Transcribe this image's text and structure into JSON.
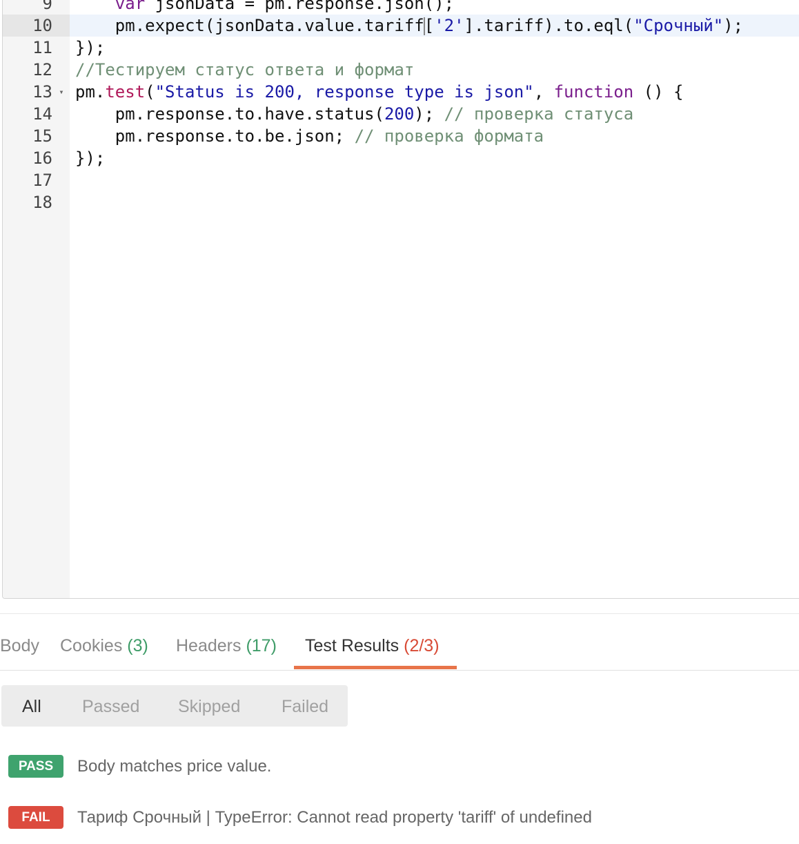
{
  "editor": {
    "lines": [
      {
        "n": "9",
        "active": false,
        "fold": false,
        "tokens": [
          {
            "t": "    ",
            "c": "text"
          },
          {
            "t": "var",
            "c": "kw"
          },
          {
            "t": " jsonData = pm.response.json();",
            "c": "text"
          }
        ]
      },
      {
        "n": "10",
        "active": true,
        "fold": false,
        "tokens": [
          {
            "t": "    pm.expect(jsonData.value.tariff",
            "c": "text"
          },
          {
            "t": "|",
            "c": "cursor"
          },
          {
            "t": "[",
            "c": "text"
          },
          {
            "t": "'2'",
            "c": "str"
          },
          {
            "t": "].tariff).to.eql(",
            "c": "text"
          },
          {
            "t": "\"Срочный\"",
            "c": "str"
          },
          {
            "t": ");",
            "c": "text"
          }
        ]
      },
      {
        "n": "11",
        "active": false,
        "fold": false,
        "tokens": [
          {
            "t": "});",
            "c": "text"
          }
        ]
      },
      {
        "n": "12",
        "active": false,
        "fold": false,
        "tokens": [
          {
            "t": "//Тестируем статус ответа и формат",
            "c": "com"
          }
        ]
      },
      {
        "n": "13",
        "active": false,
        "fold": true,
        "tokens": [
          {
            "t": "pm.",
            "c": "text"
          },
          {
            "t": "test",
            "c": "fn"
          },
          {
            "t": "(",
            "c": "text"
          },
          {
            "t": "\"Status is 200, response type is json\"",
            "c": "str"
          },
          {
            "t": ", ",
            "c": "text"
          },
          {
            "t": "function",
            "c": "kw"
          },
          {
            "t": " () {",
            "c": "text"
          }
        ]
      },
      {
        "n": "14",
        "active": false,
        "fold": false,
        "tokens": [
          {
            "t": "    pm.response.to.have.status(",
            "c": "text"
          },
          {
            "t": "200",
            "c": "num"
          },
          {
            "t": "); ",
            "c": "text"
          },
          {
            "t": "// проверка статуса",
            "c": "com"
          }
        ]
      },
      {
        "n": "15",
        "active": false,
        "fold": false,
        "tokens": [
          {
            "t": "    pm.response.to.be.json; ",
            "c": "text"
          },
          {
            "t": "// проверка формата",
            "c": "com"
          }
        ]
      },
      {
        "n": "16",
        "active": false,
        "fold": false,
        "tokens": [
          {
            "t": "});",
            "c": "text"
          }
        ]
      },
      {
        "n": "17",
        "active": false,
        "fold": false,
        "tokens": []
      },
      {
        "n": "18",
        "active": false,
        "fold": false,
        "tokens": []
      }
    ]
  },
  "tabs": {
    "body": {
      "label": "Body"
    },
    "cookies": {
      "label": "Cookies",
      "count": "(3)"
    },
    "headers": {
      "label": "Headers",
      "count": "(17)"
    },
    "test_results": {
      "label": "Test Results",
      "count": "(2/3)"
    }
  },
  "filters": {
    "all": "All",
    "passed": "Passed",
    "skipped": "Skipped",
    "failed": "Failed"
  },
  "results": [
    {
      "status": "PASS",
      "text": "Body matches price value."
    },
    {
      "status": "FAIL",
      "text": "Тариф Срочный | TypeError: Cannot read property 'tariff' of undefined"
    }
  ],
  "colors": {
    "accent": "#e8744a",
    "pass": "#3fa36e",
    "fail": "#dc4b3e",
    "count_green": "#3f9c68",
    "count_red": "#d84a35"
  }
}
